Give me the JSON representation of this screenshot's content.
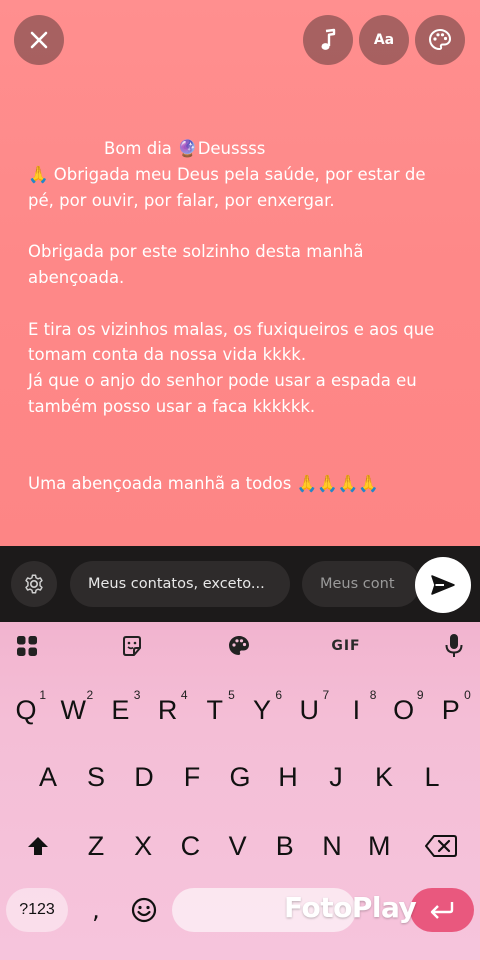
{
  "header": {
    "close_icon": "close-icon",
    "music_icon": "music-note-icon",
    "text_style_label": "Aa",
    "palette_icon": "palette-icon"
  },
  "status": {
    "background_color": "#ff8a8a",
    "lines": [
      "Bom dia 🔮Deussss",
      "🙏 Obrigada meu Deus pela saúde, por estar de",
      "pé, por ouvir, por falar, por enxergar.",
      "",
      "Obrigada por este solzinho desta manhã",
      "abençoada.",
      "",
      "E tira os vizinhos malas, os fuxiqueiros e aos que",
      "tomam conta da nossa vida kkkk.",
      "Já que o anjo do senhor pode usar a espada eu",
      "também posso usar a faca kkkkkk.",
      "",
      "",
      "Uma abençoada manhã a todos 🙏🙏🙏🙏"
    ]
  },
  "send_bar": {
    "settings_icon": "gear-icon",
    "privacy_option_1": "Meus contatos, exceto...",
    "privacy_option_2": "Meus cont",
    "send_icon": "send-arrow-icon"
  },
  "keyboard": {
    "toolbar": {
      "apps_icon": "grid-icon",
      "sticker_icon": "sticker-icon",
      "theme_icon": "palette-icon",
      "gif_label": "GIF",
      "mic_icon": "microphone-icon"
    },
    "row1": [
      {
        "key": "Q",
        "sup": "1"
      },
      {
        "key": "W",
        "sup": "2"
      },
      {
        "key": "E",
        "sup": "3"
      },
      {
        "key": "R",
        "sup": "4"
      },
      {
        "key": "T",
        "sup": "5"
      },
      {
        "key": "Y",
        "sup": "6"
      },
      {
        "key": "U",
        "sup": "7"
      },
      {
        "key": "I",
        "sup": "8"
      },
      {
        "key": "O",
        "sup": "9"
      },
      {
        "key": "P",
        "sup": "0"
      }
    ],
    "row2": [
      "A",
      "S",
      "D",
      "F",
      "G",
      "H",
      "J",
      "K",
      "L"
    ],
    "row3": [
      "Z",
      "X",
      "C",
      "V",
      "B",
      "N",
      "M"
    ],
    "num_label": "?123",
    "comma_label": ",",
    "emoji_icon": "smiley-icon",
    "enter_icon": "enter-icon",
    "shift_icon": "shift-icon",
    "backspace_icon": "backspace-icon",
    "accent_color": "#e9587e"
  },
  "watermark": "FotoPlay"
}
